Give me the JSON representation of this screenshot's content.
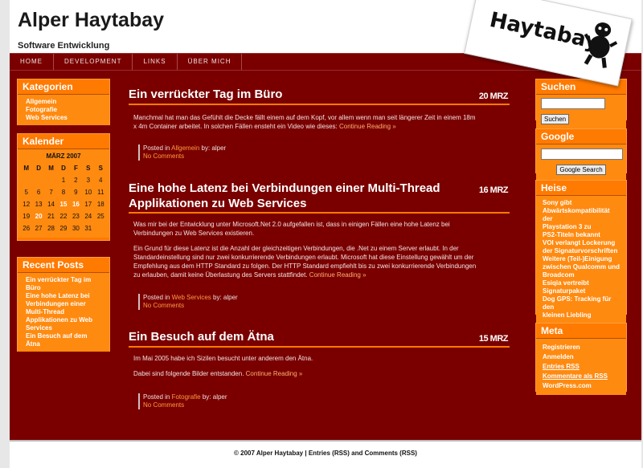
{
  "header": {
    "title": "Alper Haytabay",
    "tagline": "Software Entwicklung",
    "logo_text": "Haytabay",
    "logo_icon": "mascot-silhouette-icon"
  },
  "nav": [
    "HOME",
    "DEVELOPMENT",
    "LINKS",
    "ÜBER MICH"
  ],
  "left_sidebar": {
    "categories_title": "Kategorien",
    "categories": [
      "Allgemein",
      "Fotografie",
      "Web Services"
    ],
    "calendar_title": "Kalender",
    "calendar_month": "MÄRZ 2007",
    "weekdays": [
      "M",
      "D",
      "M",
      "D",
      "F",
      "S",
      "S"
    ],
    "weeks": [
      [
        "",
        "",
        "",
        "1",
        "2",
        "3",
        "4"
      ],
      [
        "5",
        "6",
        "7",
        "8",
        "9",
        "10",
        "11"
      ],
      [
        "12",
        "13",
        "14",
        "15",
        "16",
        "17",
        "18"
      ],
      [
        "19",
        "20",
        "21",
        "22",
        "23",
        "24",
        "25"
      ],
      [
        "26",
        "27",
        "28",
        "29",
        "30",
        "31",
        ""
      ]
    ],
    "calendar_links": [
      "15",
      "16",
      "20"
    ],
    "recent_title": "Recent Posts",
    "recent_lines": [
      "Ein verrückter Tag im",
      "Büro",
      "Eine hohe Latenz bei",
      "Verbindungen einer",
      "Multi-Thread",
      "Applikationen zu Web",
      "Services",
      "Ein Besuch auf dem Ätna"
    ]
  },
  "posts": [
    {
      "title_lines": [
        "Ein verrückter Tag im Büro"
      ],
      "date": "20 MRZ",
      "paragraphs": [
        [
          "Manchmal hat man das Gefühlt die Decke fällt einem auf dem Kopf, vor allem wenn man seit längerer Zeit in einem 18m",
          "x 4m Container arbeitet. In solchen Fällen ensteht ein Video wie dieses: "
        ]
      ],
      "more": "Continue Reading »",
      "posted_in": "Posted in",
      "category": "Allgemein",
      "by": " by: alper",
      "comments": "No Comments"
    },
    {
      "title_lines": [
        "Eine hohe Latenz bei Verbindungen einer Multi-Thread",
        "Applikationen zu Web Services"
      ],
      "date": "16 MRZ",
      "paragraphs": [
        [
          "Was mir bei der Entwicklung unter Microsoft.Net 2.0 aufgefallen ist, dass in einigen Fällen eine hohe Latenz bei",
          "Verbindungen zu Web Services existieren."
        ],
        [
          "Ein Grund für diese Latenz ist die Anzahl der gleichzeitigen Verbindungen, die .Net zu einem Server erlaubt. In der",
          "Standardeinstellung sind nur zwei konkurrierende Verbindungen erlaubt. Microsoft hat diese Einstellung gewählt um der",
          "Empfehlung aus dem HTTP Standard zu folgen. Der HTTP Standard empfiehlt bis zu zwei konkurrierende Verbindungen",
          "zu erlauben, damit keine Überlastung des Servers stattfindet. "
        ]
      ],
      "more": "Continue Reading »",
      "posted_in": "Posted in",
      "category": "Web Services",
      "by": " by: alper",
      "comments": "No Comments"
    },
    {
      "title_lines": [
        "Ein Besuch auf dem Ätna"
      ],
      "date": "15 MRZ",
      "paragraphs": [
        [
          "Im Mai 2005 habe ich Sizilen besucht unter anderem den Ätna."
        ],
        [
          "Dabei sind folgende Bilder entstanden. "
        ]
      ],
      "more": "Continue Reading »",
      "posted_in": "Posted in",
      "category": "Fotografie",
      "by": " by: alper",
      "comments": "No Comments"
    }
  ],
  "right_sidebar": {
    "search_title": "Suchen",
    "search_button": "Suchen",
    "google_title": "Google",
    "google_button": "Google Search",
    "heise_title": "Heise",
    "heise_lines": [
      "Sony gibt",
      "Abwärtskompatibilität der",
      "Playstation 3 zu",
      "PS2-Titeln bekannt",
      "VOI verlangt Lockerung",
      "der Signaturvorschriften",
      "Weitere (Teil-)Einigung",
      "zwischen Qualcomm und",
      "Broadcom",
      "Esiqia vertreibt",
      "Signaturpaket",
      "Dog GPS: Tracking für den",
      "kleinen Liebling"
    ],
    "meta_title": "Meta",
    "meta_items": [
      "Registrieren",
      "Anmelden",
      "Entries RSS",
      "Kommentare als RSS",
      "WordPress.com"
    ]
  },
  "footer": {
    "copyright": "© 2007 Alper Haytabay | ",
    "entries": "Entries (RSS)",
    "and": " and ",
    "comments": "Comments (RSS)"
  },
  "colors": {
    "background": "#7a0000",
    "accent": "#ff7a00",
    "link": "#ff9a40"
  }
}
